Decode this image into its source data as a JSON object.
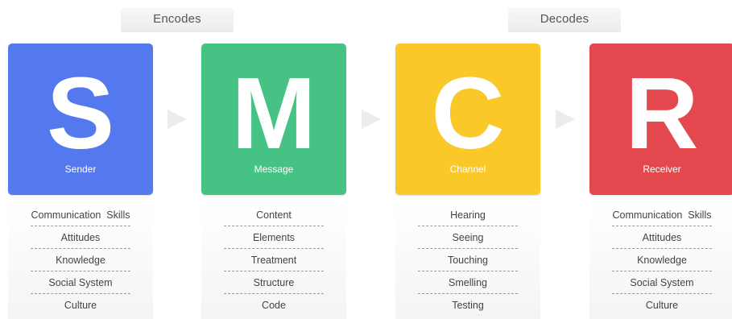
{
  "phases": {
    "encodes": "Encodes",
    "decodes": "Decodes"
  },
  "colors": {
    "sender": "#5479ee",
    "message": "#46c384",
    "channel": "#fac828",
    "receiver": "#e4484f",
    "arrow": "#ececec"
  },
  "cards": [
    {
      "letter": "S",
      "role": "Sender",
      "items": [
        "Communication  Skills",
        "Attitudes",
        "Knowledge",
        "Social System",
        "Culture"
      ]
    },
    {
      "letter": "M",
      "role": "Message",
      "items": [
        "Content",
        "Elements",
        "Treatment",
        "Structure",
        "Code"
      ]
    },
    {
      "letter": "C",
      "role": "Channel",
      "items": [
        "Hearing",
        "Seeing",
        "Touching",
        "Smelling",
        "Testing"
      ]
    },
    {
      "letter": "R",
      "role": "Receiver",
      "items": [
        "Communication  Skills",
        "Attitudes",
        "Knowledge",
        "Social System",
        "Culture"
      ]
    }
  ]
}
